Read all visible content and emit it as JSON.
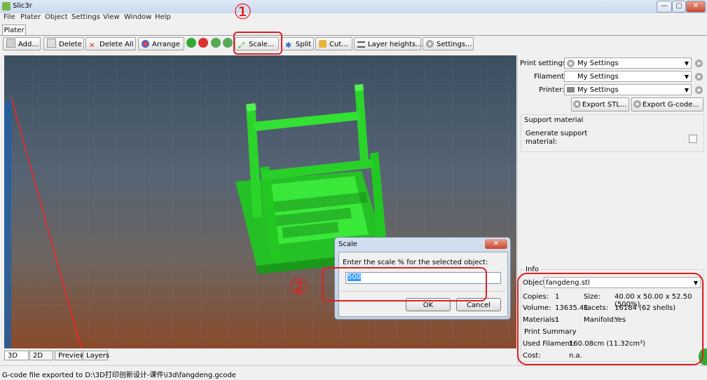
{
  "window": {
    "title": "Slic3r",
    "min_glyph": "—",
    "max_glyph": "▢",
    "close_glyph": "✕"
  },
  "menu": [
    "File",
    "Plater",
    "Object",
    "Settings",
    "View",
    "Window",
    "Help"
  ],
  "tabs": {
    "plater": "Plater"
  },
  "toolbar": {
    "add": "Add...",
    "delete": "Delete",
    "delete_all": "Delete All",
    "arrange": "Arrange",
    "scale": "Scale...",
    "split": "Split",
    "cut": "Cut...",
    "layer_heights": "Layer heights...",
    "settings": "Settings..."
  },
  "annotations": {
    "one": "①",
    "two": "②"
  },
  "settings": {
    "print_label": "Print settings:",
    "print_value": "My Settings",
    "filament_label": "Filament:",
    "filament_value": "My Settings",
    "printer_label": "Printer:",
    "printer_value": "My Settings",
    "export_stl": "Export STL...",
    "export_gcode": "Export G-code..."
  },
  "support": {
    "title": "Support material",
    "generate_label": "Generate support material:",
    "generate_checked": false
  },
  "info": {
    "title": "Info",
    "object_label": "Object:",
    "object_value": "fangdeng.stl",
    "copies_label": "Copies:",
    "copies_value": "1",
    "size_label": "Size:",
    "size_value": "40.00 x 50.00 x 52.50 (500%)",
    "volume_label": "Volume:",
    "volume_value": "13635.41",
    "facets_label": "Facets:",
    "facets_value": "16184 (62 shells)",
    "materials_label": "Materials:",
    "materials_value": "1",
    "manifold_label": "Manifold:",
    "manifold_value": "Yes"
  },
  "print_summary": {
    "title": "Print Summary",
    "filament_label": "Used Filament:",
    "filament_value": "160.08cm (11.32cm³)",
    "cost_label": "Cost:",
    "cost_value": "n.a."
  },
  "dialog": {
    "title": "Scale",
    "close_glyph": "✕",
    "prompt": "Enter the scale % for the selected object:",
    "value": "500",
    "ok": "OK",
    "cancel": "Cancel"
  },
  "view_tabs": [
    "3D",
    "2D",
    "Preview",
    "Layers"
  ],
  "status": "G-code file exported to D:\\3D打印创新设计-课件\\i3d\\fangdeng.gcode",
  "colors": {
    "model": "#22dd22",
    "annotation": "#e02020"
  }
}
